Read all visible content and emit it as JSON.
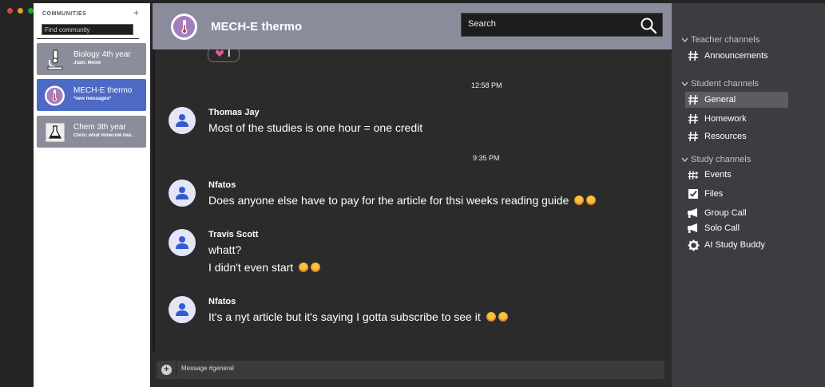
{
  "communities": {
    "header": "COMMUNITIES",
    "add_label": "+",
    "search_placeholder": "Find community",
    "items": [
      {
        "name": "Biology 4th year",
        "sub": "Juan: Meow",
        "icon": "microscope-icon"
      },
      {
        "name": "MECH-E thermo",
        "sub": "*new messages*",
        "icon": "thermometer-icon"
      },
      {
        "name": "Chem 3th year",
        "sub": "Chris: what molecule has..",
        "icon": "flask-icon"
      }
    ]
  },
  "chat": {
    "title": "MECH-E thermo",
    "search_placeholder": "Search",
    "message_placeholder": "Message #general",
    "timestamps": [
      "12:58 PM",
      "9:35 PM"
    ],
    "messages": [
      {
        "author": "Thomas Jay",
        "lines": [
          "Most of the studies is one hour = one credit"
        ]
      },
      {
        "author": "Nfatos",
        "lines": [
          "Does anyone else have to pay for the article for thsi weeks reading guide"
        ]
      },
      {
        "author": "Travis Scott",
        "lines": [
          "whatt?",
          "I didn't even start"
        ]
      },
      {
        "author": "Nfatos",
        "lines": [
          "It's a nyt article but it's saying I gotta subscribe to see it"
        ]
      }
    ]
  },
  "channels": {
    "groups": [
      {
        "label": "Teacher channels",
        "items": [
          {
            "label": "Announcements",
            "icon": "hash-icon"
          }
        ]
      },
      {
        "label": "Student channels",
        "items": [
          {
            "label": "General",
            "icon": "hash-icon",
            "active": true
          },
          {
            "label": "Homework",
            "icon": "hash-icon"
          },
          {
            "label": "Resources",
            "icon": "hash-icon"
          }
        ]
      },
      {
        "label": "Study channels",
        "items": [
          {
            "label": "Events",
            "icon": "events-icon"
          },
          {
            "label": "Files",
            "icon": "checkbox-icon"
          },
          {
            "label": "Group Call",
            "icon": "megaphone-icon"
          },
          {
            "label": "Solo Call",
            "icon": "megaphone-icon"
          },
          {
            "label": "AI Study Buddy",
            "icon": "gear-icon"
          }
        ]
      }
    ]
  },
  "colors": {
    "accent": "#4d6ac4",
    "header": "#8a8c9c",
    "sidebar": "#3b3d40"
  }
}
